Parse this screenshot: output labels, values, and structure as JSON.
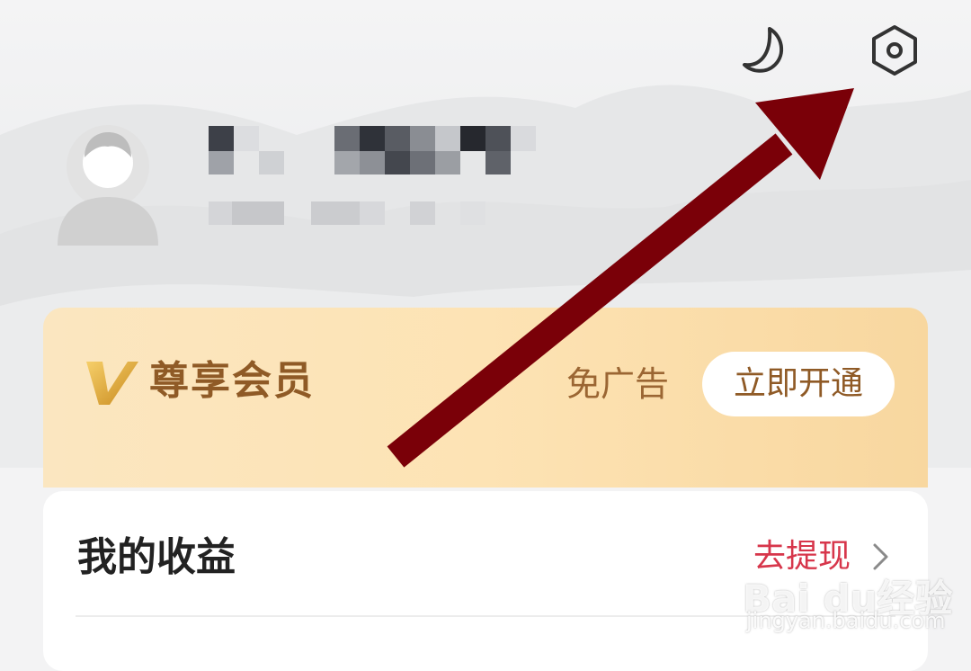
{
  "header": {
    "night_mode_icon": "moon-icon",
    "settings_icon": "settings-hexagon-icon"
  },
  "profile": {
    "avatar_icon": "default-avatar-icon",
    "name_obscured": true
  },
  "vip": {
    "logo_icon": "gold-v-icon",
    "title": "尊享会员",
    "benefit": "免广告",
    "button_label": "立即开通"
  },
  "earnings": {
    "title": "我的收益",
    "action_label": "去提现",
    "chevron_icon": "chevron-right-icon"
  },
  "annotation": {
    "arrow_icon": "red-arrow-pointing-to-settings",
    "color": "#7a0008"
  },
  "watermark": {
    "logo": "Bai du经验",
    "url": "jingyan.baidu.com"
  },
  "colors": {
    "vip_text": "#8f5a26",
    "withdraw_red": "#d7364b",
    "icon_dark": "#333333"
  }
}
